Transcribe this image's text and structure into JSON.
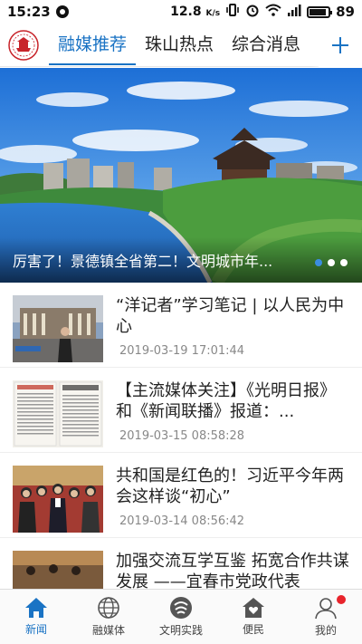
{
  "status_bar": {
    "time": "15:23",
    "speed_value": "12.8",
    "speed_unit": "K/s",
    "battery": "89"
  },
  "top_tabs": {
    "items": [
      {
        "label": "融媒推荐",
        "active": true
      },
      {
        "label": "珠山热点",
        "active": false
      },
      {
        "label": "综合消息",
        "active": false
      }
    ],
    "add_icon": "plus-icon",
    "accent_color": "#1a73c4"
  },
  "banner": {
    "caption": "厉害了！景德镇全省第二！文明城市年...",
    "slide_count": 3,
    "active_slide": 1
  },
  "news": [
    {
      "title": "“洋记者”学习笔记 | 以人民为中心",
      "time": "2019-03-19 17:01:44"
    },
    {
      "title": "【主流媒体关注】《光明日报》和《新闻联播》报道：...",
      "time": "2019-03-15 08:58:28"
    },
    {
      "title": "共和国是红色的！习近平今年两会这样谈“初心”",
      "time": "2019-03-14 08:56:42"
    },
    {
      "title": "加强交流互学互鉴 拓宽合作共谋发展 ——宜春市党政代表",
      "time": ""
    }
  ],
  "bottom_nav": {
    "items": [
      {
        "label": "新闻",
        "icon": "home-icon",
        "active": true
      },
      {
        "label": "融媒体",
        "icon": "globe-icon",
        "active": false
      },
      {
        "label": "文明实践",
        "icon": "practice-icon",
        "active": false
      },
      {
        "label": "便民",
        "icon": "house-heart-icon",
        "active": false
      },
      {
        "label": "我的",
        "icon": "user-icon",
        "active": false,
        "badge": true
      }
    ]
  }
}
